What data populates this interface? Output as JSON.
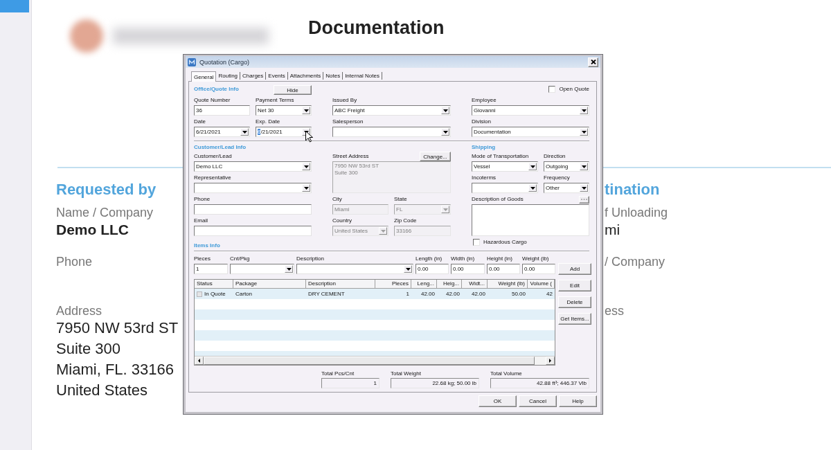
{
  "document": {
    "title": "Documentation",
    "requested_by": {
      "heading": "Requested by",
      "fields": [
        {
          "kind": "name",
          "label": "Name / Company",
          "value": "Demo LLC"
        },
        {
          "kind": "contact",
          "label": "Phone"
        },
        {
          "kind": "address",
          "label": "Address",
          "lines": [
            "7950 NW 53rd ST",
            "Suite 300",
            "Miami, FL. 33166",
            "United States"
          ]
        }
      ]
    },
    "destination": {
      "heading": "tination",
      "fields": [
        {
          "kind": "place",
          "label": "f Unloading",
          "value": "mi"
        },
        {
          "kind": "contact",
          "label": "/ Company"
        },
        {
          "kind": "address",
          "label": "ess"
        }
      ]
    }
  },
  "dialog": {
    "title": "Quotation (Cargo)",
    "tabs": [
      {
        "label": "General",
        "selected": true
      },
      {
        "label": "Routing",
        "selected": false
      },
      {
        "label": "Charges",
        "selected": false
      },
      {
        "label": "Events",
        "selected": false
      },
      {
        "label": "Attachments",
        "selected": false
      },
      {
        "label": "Notes",
        "selected": false
      },
      {
        "label": "Internal Notes",
        "selected": false
      }
    ],
    "office_quote_info": {
      "heading": "Office/Quote Info",
      "hide_button": "Hide",
      "open_quote": {
        "label": "Open Quote",
        "checked": false
      },
      "fields": [
        {
          "label": "Quote Number",
          "kind": "text",
          "value": "36",
          "disabled": false,
          "focused": false
        },
        {
          "label": "Payment Terms",
          "kind": "combo",
          "value": "Net 30",
          "disabled": false,
          "focused": false
        },
        {
          "label": "Issued By",
          "kind": "combo",
          "value": "ABC Freight",
          "disabled": false,
          "focused": false
        },
        {
          "label": "Employee",
          "kind": "combo",
          "value": "Giovanni",
          "disabled": false,
          "focused": false
        },
        {
          "label": "Date",
          "kind": "date",
          "value": "6/21/2021",
          "disabled": false,
          "focused": false
        },
        {
          "label": "Exp. Date",
          "kind": "date",
          "value": "6/21/2021",
          "disabled": false,
          "focused": true
        },
        {
          "label": "Salesperson",
          "kind": "combo",
          "disabled": false,
          "focused": false
        },
        {
          "label": "Division",
          "kind": "combo",
          "value": "Documentation",
          "disabled": false,
          "focused": false
        }
      ]
    },
    "customer_lead_info": {
      "heading": "Customer/Lead Info",
      "fields": [
        {
          "label": "Customer/Lead",
          "kind": "combo",
          "value": "Demo LLC",
          "disabled": false,
          "focused": false
        },
        {
          "label": "Street Address",
          "kind": "textarea",
          "lines": [
            "7950 NW 53rd ST",
            "Suite 300"
          ],
          "button": "Change...",
          "disabled": true,
          "focused": false
        },
        {
          "label": "Representative",
          "kind": "combo",
          "disabled": false,
          "focused": false
        },
        {
          "label": "Phone",
          "kind": "text",
          "disabled": false,
          "focused": false
        },
        {
          "label": "City",
          "kind": "text",
          "value": "Miami",
          "disabled": true,
          "focused": false
        },
        {
          "label": "State",
          "kind": "combo",
          "value": "FL",
          "disabled": true,
          "focused": false
        },
        {
          "label": "Email",
          "kind": "text",
          "disabled": false,
          "focused": false
        },
        {
          "label": "Country",
          "kind": "combo",
          "value": "United States",
          "disabled": true,
          "focused": false
        },
        {
          "label": "Zip Code",
          "kind": "text",
          "value": "33166",
          "disabled": true,
          "focused": false
        }
      ]
    },
    "shipping": {
      "heading": "Shipping",
      "fields": [
        {
          "label": "Mode of Transportation",
          "kind": "combo",
          "value": "Vessel",
          "disabled": false,
          "focused": false
        },
        {
          "label": "Direction",
          "kind": "combo",
          "value": "Outgoing",
          "disabled": false,
          "focused": false
        },
        {
          "label": "Incoterms",
          "kind": "combo",
          "disabled": false,
          "focused": false
        },
        {
          "label": "Frequency",
          "kind": "combo",
          "value": "Other",
          "disabled": false,
          "focused": false
        },
        {
          "label": "Description of Goods",
          "kind": "textarea",
          "more_button": true,
          "disabled": false,
          "focused": false
        }
      ],
      "hazardous_cargo": {
        "label": "Hazardous Cargo",
        "checked": false
      }
    },
    "items_info": {
      "heading": "Items Info",
      "fields": [
        {
          "label": "Pieces",
          "kind": "text",
          "value": "1",
          "disabled": false,
          "focused": false
        },
        {
          "label": "Cnt/Pkg",
          "kind": "combo",
          "disabled": false,
          "focused": false
        },
        {
          "label": "Description",
          "kind": "combo",
          "disabled": false,
          "focused": false
        },
        {
          "label": "Length (in)",
          "kind": "text",
          "value": "0.00",
          "disabled": false,
          "focused": false
        },
        {
          "label": "Width (in)",
          "kind": "text",
          "value": "0.00",
          "disabled": false,
          "focused": false
        },
        {
          "label": "Height (in)",
          "kind": "text",
          "value": "0.00",
          "disabled": false,
          "focused": false
        },
        {
          "label": "Weight (lb)",
          "kind": "text",
          "value": "0.00",
          "disabled": false,
          "focused": false
        }
      ],
      "buttons": [
        "Add",
        "Edit",
        "Delete",
        "Get Items..."
      ],
      "table": {
        "columns": [
          {
            "label": "Status",
            "kind": "status"
          },
          {
            "label": "Package",
            "kind": "text"
          },
          {
            "label": "Description",
            "kind": "text"
          },
          {
            "label": "Pieces",
            "kind": "number"
          },
          {
            "label": "Leng...",
            "kind": "number"
          },
          {
            "label": "Heig...",
            "kind": "number"
          },
          {
            "label": "Widt...",
            "kind": "number"
          },
          {
            "label": "Weight (lb)",
            "kind": "number"
          },
          {
            "label": "Volume (",
            "kind": "number"
          }
        ],
        "rows": [
          {
            "cells": [
              "In Quote",
              "Carton",
              "DRY CEMENT",
              "1",
              "42.00",
              "42.00",
              "42.00",
              "50.00",
              "42"
            ]
          }
        ]
      },
      "totals": [
        {
          "label": "Total Pcs/Cnt",
          "value": "1"
        },
        {
          "label": "Total Weight",
          "value": "22.68 kg; 50.00 lb"
        },
        {
          "label": "Total Volume",
          "value": "42.88 ft³; 446.37 Vlb"
        }
      ]
    },
    "buttons": [
      "OK",
      "Cancel",
      "Help"
    ]
  }
}
